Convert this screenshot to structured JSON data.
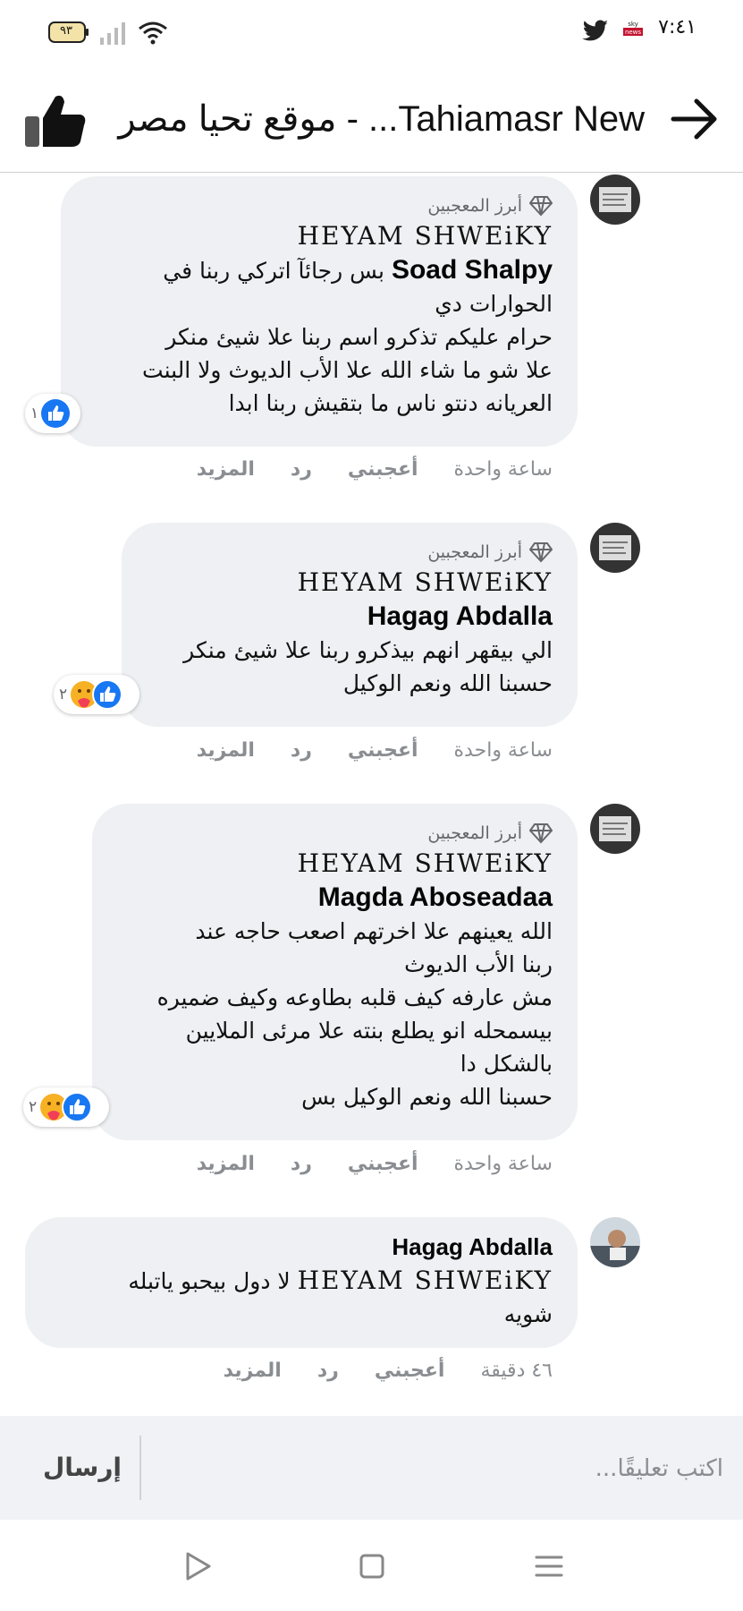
{
  "status_bar": {
    "time": "٧:٤١",
    "battery": "٩٣"
  },
  "header": {
    "title": "موقع تحيا مصر - ...Tahiamasr New"
  },
  "comments": [
    {
      "fan_label": "أبرز المعجبين",
      "tagged_name": "HEYAM SHWEiKY",
      "author": "Soad Shalpy",
      "text_lines": [
        "بس رجائآ اتركي ربنا في",
        "الحوارات دي",
        "حرام عليكم تذكرو اسم ربنا علا شيئ منكر",
        "علا شو ما شاء الله علا الأب الديوث ولا البنت",
        "العريانه دنتو ناس ما بتقيش ربنا ابدا"
      ],
      "reaction_count": "١",
      "time": "ساعة واحدة",
      "like": "أعجبني",
      "reply": "رد",
      "more": "المزيد"
    },
    {
      "fan_label": "أبرز المعجبين",
      "tagged_name": "HEYAM SHWEiKY",
      "author": "Hagag Abdalla",
      "text_lines": [
        "الي بيقهر انهم بيذكرو ربنا علا شيئ منكر",
        "حسبنا الله ونعم الوكيل"
      ],
      "reaction_count": "٢",
      "time": "ساعة واحدة",
      "like": "أعجبني",
      "reply": "رد",
      "more": "المزيد"
    },
    {
      "fan_label": "أبرز المعجبين",
      "tagged_name": "HEYAM SHWEiKY",
      "author": "Magda Aboseadaa",
      "text_lines": [
        "الله يعينهم علا اخرتهم اصعب حاجه عند",
        "ربنا الأب الديوث",
        "مش عارفه كيف قلبه بطاوعه وكيف ضميره",
        "بيسمحله انو يطلع بنته علا مرئى الملايين",
        "بالشكل دا",
        "حسبنا الله ونعم الوكيل بس"
      ],
      "reaction_count": "٢",
      "time": "ساعة واحدة",
      "like": "أعجبني",
      "reply": "رد",
      "more": "المزيد"
    },
    {
      "author": "Hagag Abdalla",
      "text_line1_tag": "HEYAM SHWEiKY",
      "text_line1_rest": "لا دول بيحبو ياتبله",
      "text_line2": "شويه",
      "time": "٤٦ دقيقة",
      "like": "أعجبني",
      "reply": "رد",
      "more": "المزيد"
    }
  ],
  "compose": {
    "placeholder": "اكتب تعليقًا...",
    "send_label": "إرسال"
  },
  "colors": {
    "bubble": "#eef0f3",
    "like_blue": "#1877f2",
    "muted": "#8a8d91"
  }
}
